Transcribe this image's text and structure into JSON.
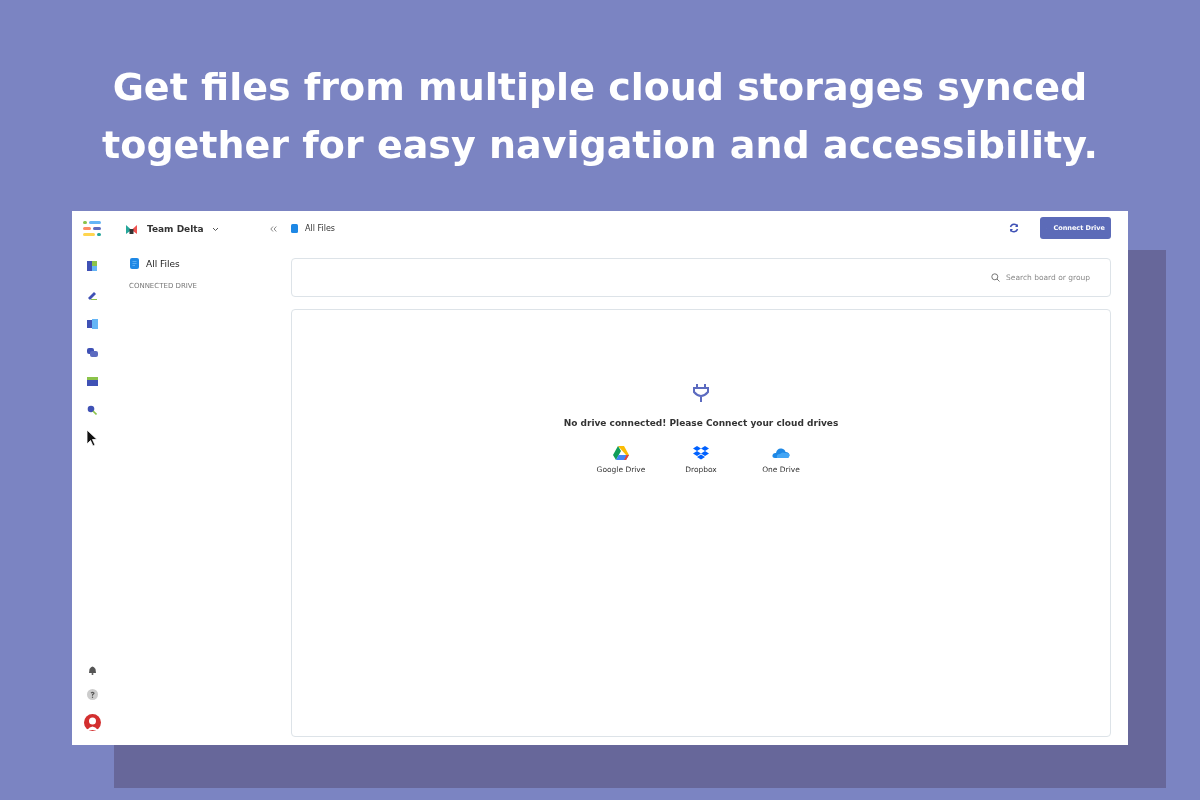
{
  "headline": "Get files from multiple cloud storages synced together for easy navigation and accessibility.",
  "sidebar": {
    "team": "Team Delta",
    "items": [
      {
        "label": "All Files"
      }
    ],
    "section": "CONNECTED DRIVE"
  },
  "header": {
    "breadcrumb": "All Files",
    "button": "Connect Drive"
  },
  "search": {
    "placeholder": "Search board or group"
  },
  "empty_state": {
    "message": "No drive connected! Please Connect your cloud drives",
    "drives": [
      {
        "kind": "google",
        "label": "Google Drive"
      },
      {
        "kind": "dropbox",
        "label": "Dropbox"
      },
      {
        "kind": "onedrive",
        "label": "One Drive"
      }
    ]
  }
}
